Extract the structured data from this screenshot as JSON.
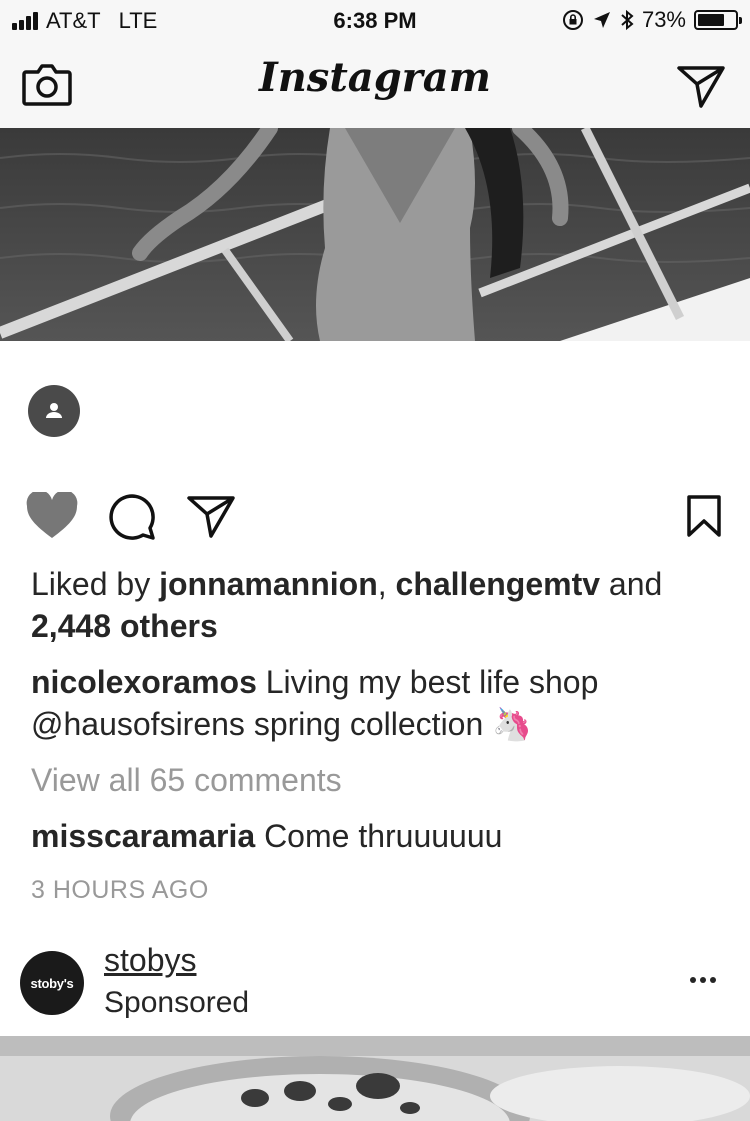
{
  "status_bar": {
    "carrier": "AT&T",
    "network": "LTE",
    "time": "6:38 PM",
    "battery": "73%",
    "battery_level": 0.73
  },
  "nav": {
    "logo": "Instagram",
    "left_icon": "camera-icon",
    "right_icon": "direct-message-icon"
  },
  "post": {
    "liked_prefix": "Liked by ",
    "liked_user_1": "jonnamannion",
    "liked_sep": ", ",
    "liked_user_2": "challengemtv",
    "liked_and": " and",
    "liked_others": "2,448 others",
    "caption_user": "nicolexoramos",
    "caption_line1": " Living my best life shop",
    "caption_line2": "@hausofsirens spring collection 🦄",
    "view_comments": "View all 65 comments",
    "comment_user": "misscaramaria",
    "comment_text": " Come thruuuuuu",
    "timestamp": "3 HOURS AGO"
  },
  "sponsored": {
    "avatar_text": "stoby's",
    "name": "stobys",
    "label": "Sponsored"
  }
}
